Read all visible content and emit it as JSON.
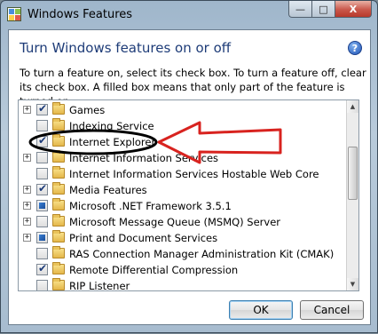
{
  "window": {
    "title": "Windows Features",
    "minimize_glyph": "—",
    "maximize_glyph": "□",
    "close_glyph": "X"
  },
  "header": {
    "title": "Turn Windows features on or off",
    "help_glyph": "?"
  },
  "description": "To turn a feature on, select its check box. To turn a feature off, clear its check box. A filled box means that only part of the feature is turned on.",
  "features": [
    {
      "label": "Games",
      "state": "checked",
      "expandable": true
    },
    {
      "label": "Indexing Service",
      "state": "unchecked",
      "expandable": false
    },
    {
      "label": "Internet Explorer",
      "state": "checked",
      "expandable": false
    },
    {
      "label": "Internet Information Services",
      "state": "unchecked",
      "expandable": true
    },
    {
      "label": "Internet Information Services Hostable Web Core",
      "state": "unchecked",
      "expandable": false
    },
    {
      "label": "Media Features",
      "state": "checked",
      "expandable": true
    },
    {
      "label": "Microsoft .NET Framework 3.5.1",
      "state": "partial",
      "expandable": true
    },
    {
      "label": "Microsoft Message Queue (MSMQ) Server",
      "state": "unchecked",
      "expandable": true
    },
    {
      "label": "Print and Document Services",
      "state": "partial",
      "expandable": true
    },
    {
      "label": "RAS Connection Manager Administration Kit (CMAK)",
      "state": "unchecked",
      "expandable": false
    },
    {
      "label": "Remote Differential Compression",
      "state": "checked",
      "expandable": false
    },
    {
      "label": "RIP Listener",
      "state": "unchecked",
      "expandable": false
    }
  ],
  "expander_glyph": "+",
  "buttons": {
    "ok": "OK",
    "cancel": "Cancel"
  },
  "colors": {
    "annotation_red": "#d8231f",
    "annotation_black": "#000000",
    "title_blue": "#1e3c78"
  }
}
